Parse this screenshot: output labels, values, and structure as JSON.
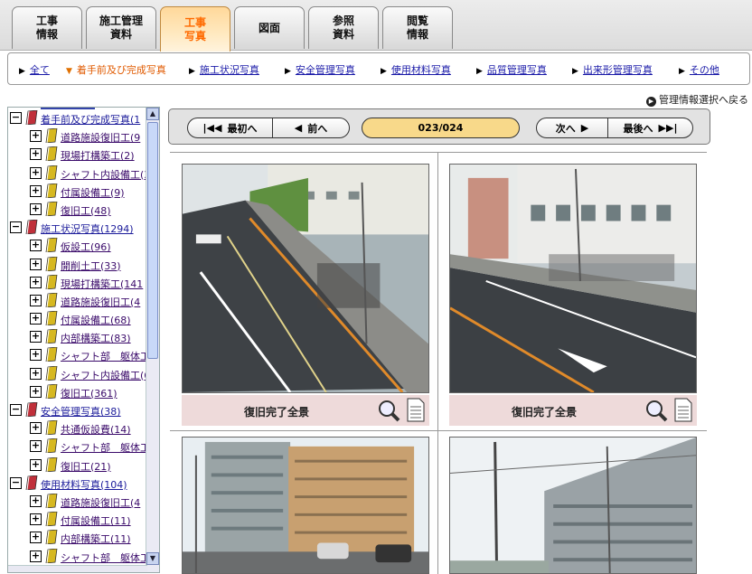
{
  "tabs": [
    {
      "label": "工事\n情報"
    },
    {
      "label": "施工管理\n資料"
    },
    {
      "label": "工事\n写真"
    },
    {
      "label": "図面"
    },
    {
      "label": "参照\n資料"
    },
    {
      "label": "閲覧\n情報"
    }
  ],
  "subnav": [
    {
      "label": "全て"
    },
    {
      "label": "着手前及び完成写真"
    },
    {
      "label": "施工状況写真"
    },
    {
      "label": "安全管理写真"
    },
    {
      "label": "使用材料写真"
    },
    {
      "label": "品質管理写真"
    },
    {
      "label": "出来形管理写真"
    },
    {
      "label": "その他"
    }
  ],
  "mgmt_link": "管理情報選択へ戻る",
  "tree": [
    {
      "label": "着手前及び完成写真(1"
    },
    {
      "label": "道路施設復旧工(9"
    },
    {
      "label": "現場打構築工(2)"
    },
    {
      "label": "シャフト内設備工(3"
    },
    {
      "label": "付属設備工(9)"
    },
    {
      "label": "復旧工(48)"
    },
    {
      "label": "施工状況写真(1294)"
    },
    {
      "label": "仮設工(96)"
    },
    {
      "label": "開削土工(33)"
    },
    {
      "label": "現場打構築工(141"
    },
    {
      "label": "道路施設復旧工(4"
    },
    {
      "label": "付属設備工(68)"
    },
    {
      "label": "内部構築工(83)"
    },
    {
      "label": "シャフト部　躯体工"
    },
    {
      "label": "シャフト内設備工(6"
    },
    {
      "label": "復旧工(361)"
    },
    {
      "label": "安全管理写真(38)"
    },
    {
      "label": "共通仮設費(14)"
    },
    {
      "label": "シャフト部　躯体工"
    },
    {
      "label": "復旧工(21)"
    },
    {
      "label": "使用材料写真(104)"
    },
    {
      "label": "道路施設復旧工(4"
    },
    {
      "label": "付属設備工(11)"
    },
    {
      "label": "内部構築工(11)"
    },
    {
      "label": "シャフト部　躯体工"
    }
  ],
  "pager": {
    "first": "最初へ",
    "prev": "前へ",
    "counter": "023/024",
    "next": "次へ",
    "last": "最後へ"
  },
  "photos": [
    {
      "caption": "復旧完了全景"
    },
    {
      "caption": "復旧完了全景"
    },
    {
      "caption": ""
    },
    {
      "caption": ""
    }
  ],
  "colors": {
    "active_tab_text": "#ff6a00",
    "link": "#1a1aa8",
    "counter_bg": "#f8d98a",
    "caption_bg": "#eedada"
  }
}
